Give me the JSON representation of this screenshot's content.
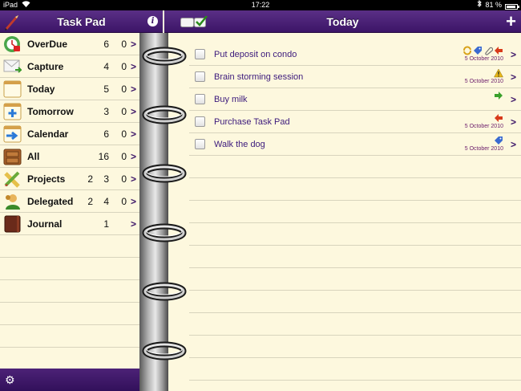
{
  "status_bar": {
    "device": "iPad",
    "time": "17:22",
    "battery": "81 %",
    "battery_level": 0.81
  },
  "sidebar": {
    "title": "Task Pad",
    "categories": [
      {
        "label": "OverDue",
        "n1": "",
        "n2": "6",
        "n3": "0",
        "icon": "overdue-clock-icon"
      },
      {
        "label": "Capture",
        "n1": "",
        "n2": "4",
        "n3": "0",
        "icon": "envelope-icon"
      },
      {
        "label": "Today",
        "n1": "",
        "n2": "5",
        "n3": "0",
        "icon": "calendar-page-icon"
      },
      {
        "label": "Tomorrow",
        "n1": "",
        "n2": "3",
        "n3": "0",
        "icon": "calendar-plus-icon"
      },
      {
        "label": "Calendar",
        "n1": "",
        "n2": "6",
        "n3": "0",
        "icon": "calendar-arrow-icon"
      },
      {
        "label": "All",
        "n1": "",
        "n2": "16",
        "n3": "0",
        "icon": "drawer-icon"
      },
      {
        "label": "Projects",
        "n1": "2",
        "n2": "3",
        "n3": "0",
        "icon": "pencil-ruler-icon"
      },
      {
        "label": "Delegated",
        "n1": "2",
        "n2": "4",
        "n3": "0",
        "icon": "person-icon"
      },
      {
        "label": "Journal",
        "n1": "",
        "n2": "1",
        "n3": "",
        "icon": "book-icon"
      }
    ]
  },
  "main": {
    "title": "Today",
    "tasks": [
      {
        "title": "Put deposit on condo",
        "date": "5 October 2010",
        "icons": [
          "repeat-icon",
          "tag-icon",
          "paperclip-icon",
          "arrow-left-red-icon"
        ]
      },
      {
        "title": "Brain storming session",
        "date": "5 October 2010",
        "icons": [
          "warning-icon"
        ]
      },
      {
        "title": "Buy milk",
        "date": "",
        "icons": [
          "arrow-right-green-icon"
        ]
      },
      {
        "title": "Purchase Task Pad",
        "date": "5 October 2010",
        "icons": [
          "arrow-left-red-icon"
        ]
      },
      {
        "title": "Walk the dog",
        "date": "5 October 2010",
        "icons": [
          "tag-icon"
        ]
      }
    ]
  },
  "colors": {
    "header": "#3c1567",
    "paper": "#fdf8de",
    "task_text": "#3c1a7c",
    "date_text": "#6a1a6a"
  }
}
